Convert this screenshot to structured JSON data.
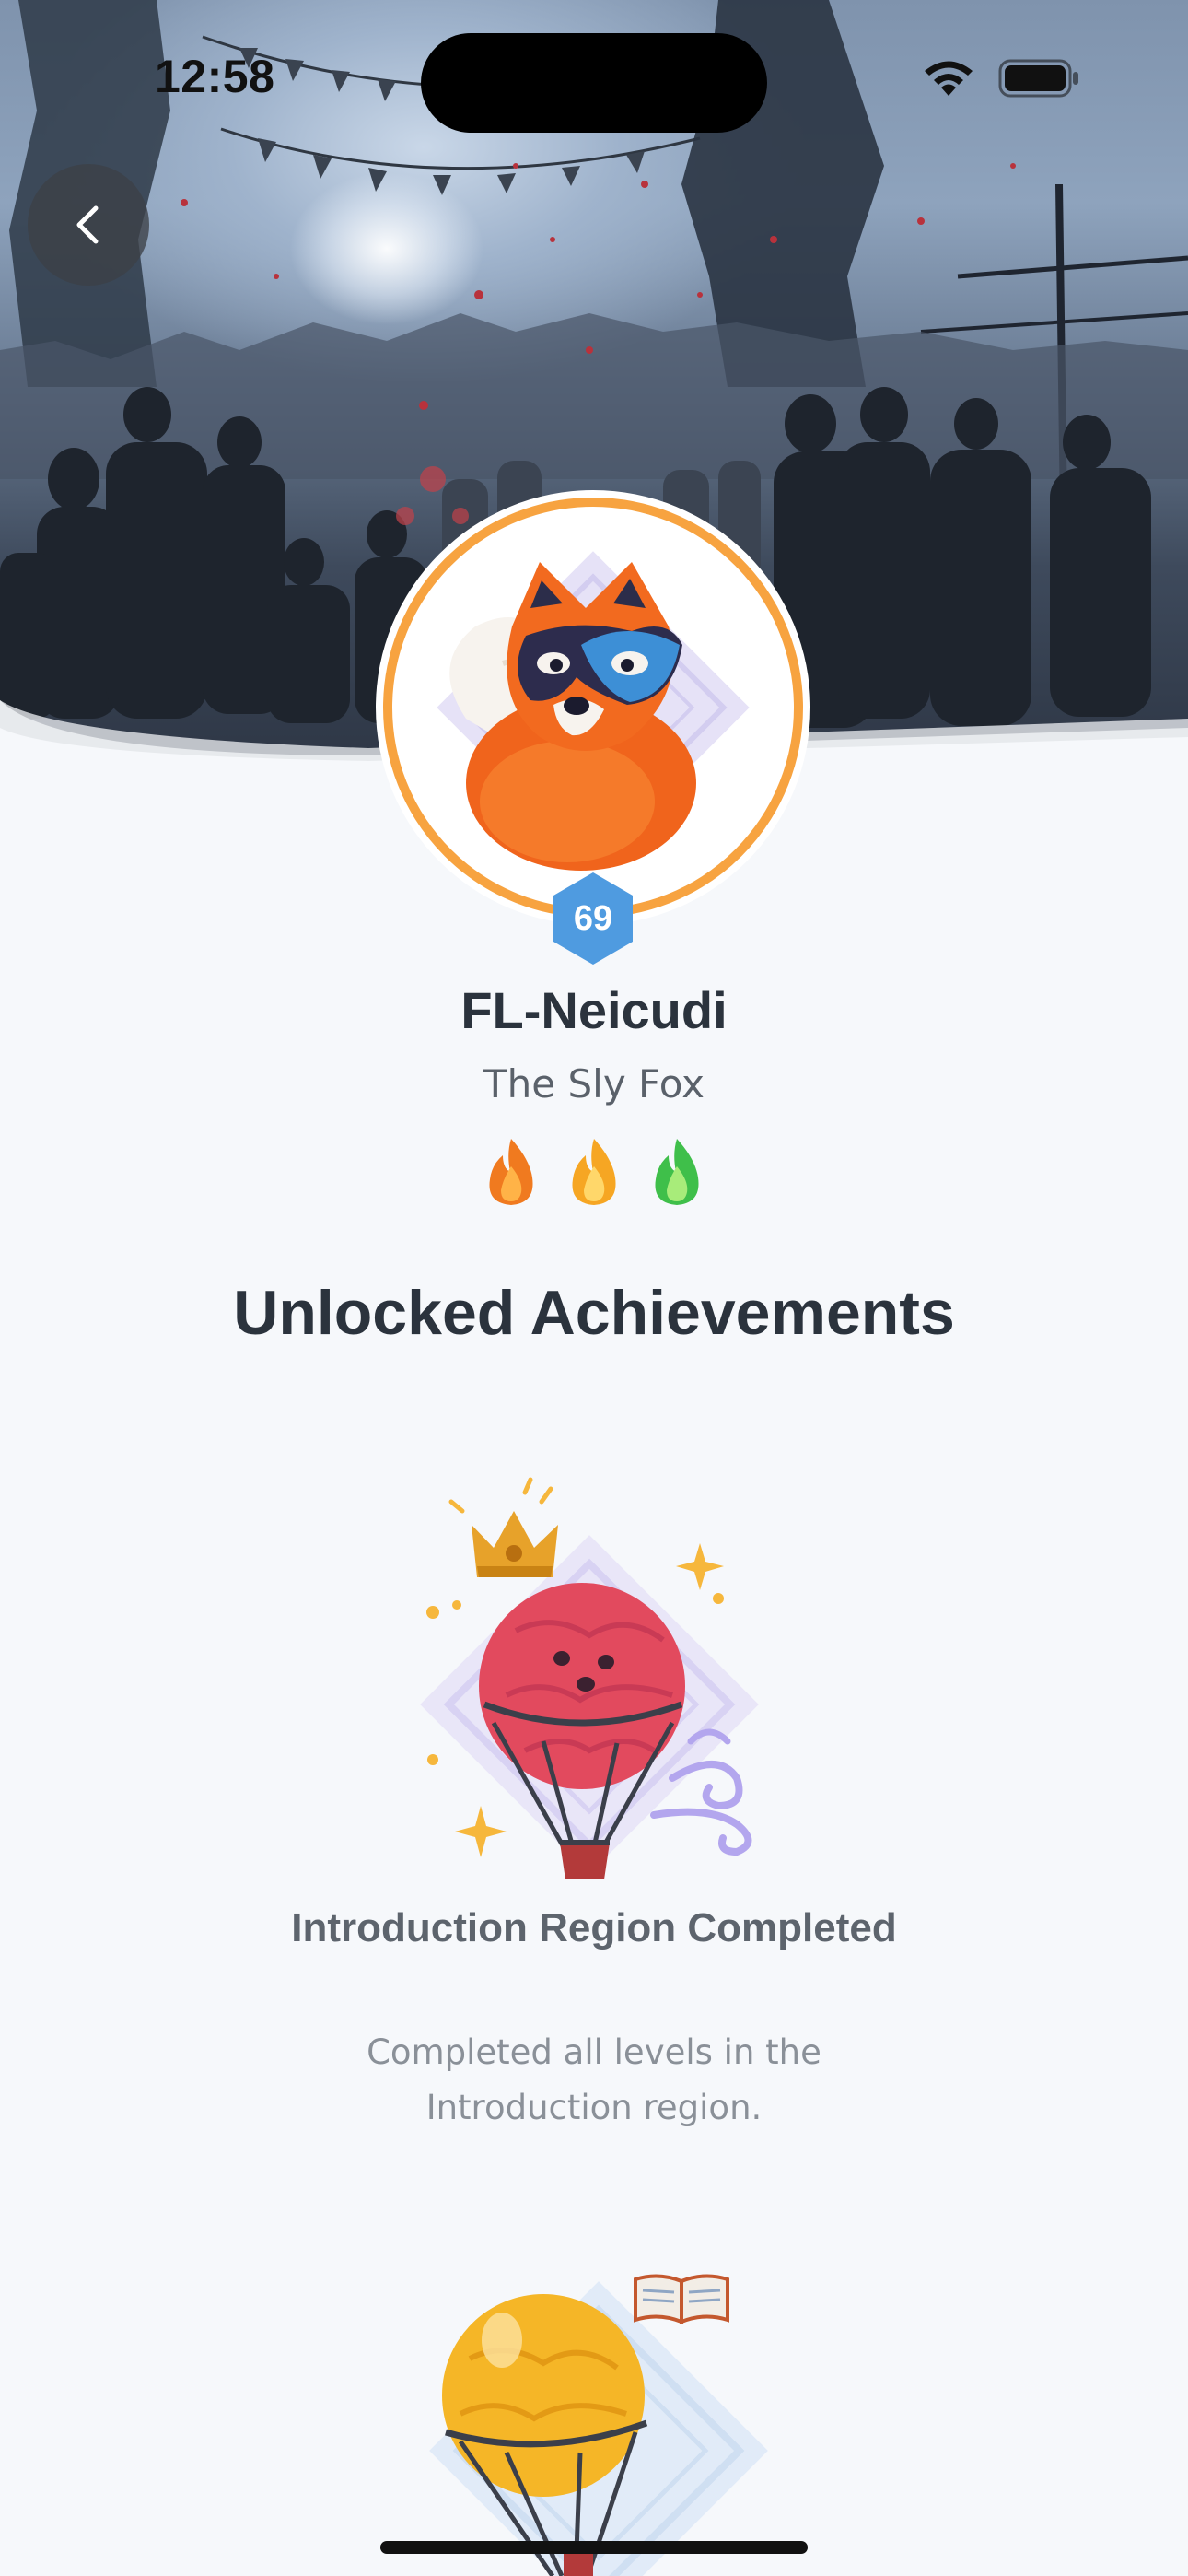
{
  "status_bar": {
    "time": "12:58",
    "icons": [
      "wifi-icon",
      "battery-icon"
    ]
  },
  "header": {
    "back_icon": "chevron-left-icon"
  },
  "profile": {
    "username": "FL-Neicudi",
    "title": "The Sly Fox",
    "level": "69",
    "avatar": "fox-avatar",
    "ring_color": "#f7a340",
    "badge_color": "#4f9be0",
    "streak_flames": [
      {
        "name": "orange-flame-icon",
        "color": "#f07a1f"
      },
      {
        "name": "yellow-flame-icon",
        "color": "#f6a623"
      },
      {
        "name": "green-flame-icon",
        "color": "#3fbf4a"
      }
    ]
  },
  "achievements": {
    "section_title": "Unlocked Achievements",
    "items": [
      {
        "icon": "red-hot-air-balloon-crown-icon",
        "title": "Introduction Region Completed",
        "description": "Completed all levels in the Introduction region."
      },
      {
        "icon": "yellow-hot-air-balloon-book-icon",
        "title": "",
        "description": ""
      }
    ]
  }
}
